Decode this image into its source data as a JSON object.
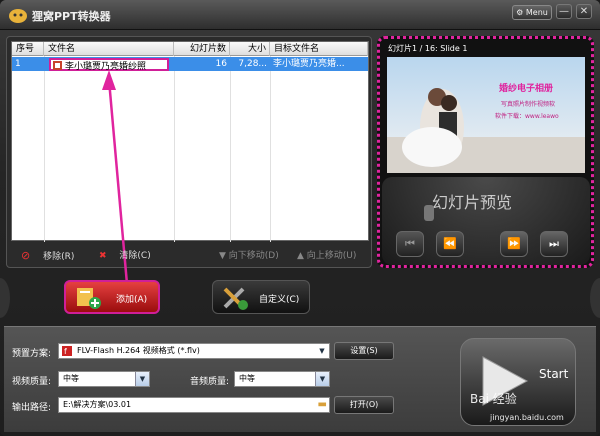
{
  "app": {
    "title": "狸窝PPT转换器",
    "menu_label": "Menu",
    "minimize": "—",
    "close": "✕"
  },
  "table": {
    "headers": [
      "序号",
      "文件名",
      "幻灯片数",
      "大小",
      "目标文件名"
    ],
    "rows": [
      {
        "index": "1",
        "filename": "李小璐贾乃亮婚纱照",
        "slides": "16",
        "size": "7,28...",
        "target": "李小璐贾乃亮婚..."
      }
    ]
  },
  "list_actions": {
    "remove": "移除(R)",
    "clear": "清除(C)",
    "move_down": "向下移动(D)",
    "move_up": "向上移动(U)"
  },
  "preview": {
    "title": "幻灯片1 / 16: Slide 1",
    "overlay_title": "婚纱电子相册",
    "overlay_sub1": "写真照片制作视频软",
    "overlay_sub2": "软件下载：www.leawo",
    "slide_label": "幻灯片预览"
  },
  "buttons": {
    "add": "添加(A)",
    "custom": "自定义(C)"
  },
  "settings": {
    "preset_label": "预置方案:",
    "preset_value": "FLV-Flash H.264 视频格式 (*.flv)",
    "settings_btn": "设置(S)",
    "video_quality_label": "视频质量:",
    "video_quality_value": "中等",
    "audio_quality_label": "音频质量:",
    "audio_quality_value": "中等",
    "output_label": "输出路径:",
    "output_value": "E:\\解决方案\\03.01",
    "open_btn": "打开(O)"
  },
  "start": {
    "label": "Start"
  },
  "watermark": {
    "brand": "Bai 经验",
    "url": "jingyan.baidu.com"
  },
  "colors": {
    "highlight": "#d01f98",
    "selection": "#3b8ee8",
    "accent": "#e0249e"
  }
}
